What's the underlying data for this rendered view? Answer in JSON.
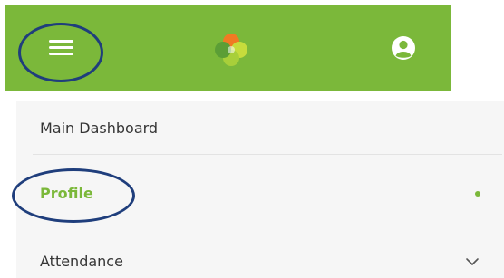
{
  "app_bar": {
    "menu_icon": "hamburger-menu-icon",
    "logo_icon": "four-leaf-clover-logo",
    "account_icon": "user-account-icon",
    "background_color": "#7bb83a"
  },
  "nav": {
    "items": [
      {
        "label": "Main Dashboard"
      },
      {
        "label": "Profile",
        "active": true,
        "indicator": "•"
      },
      {
        "label": "Attendance",
        "expand_icon": "chevron-down-icon"
      }
    ]
  },
  "annotation_color": "#1f3e7c",
  "accent_color": "#7bb83a"
}
